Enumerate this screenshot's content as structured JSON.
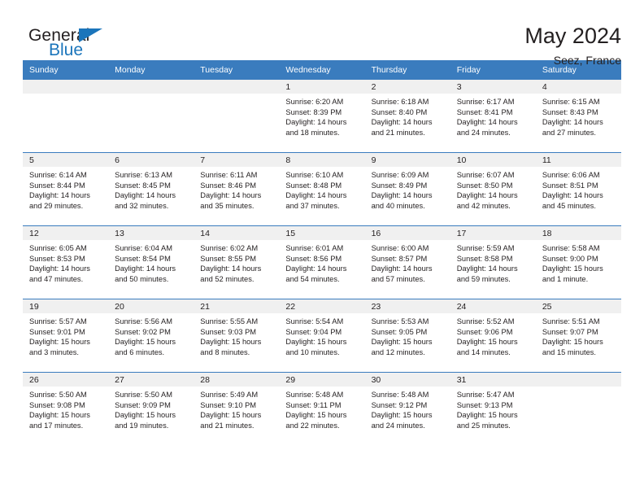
{
  "brand": {
    "name_top": "General",
    "name_bottom": "Blue",
    "accent_color": "#1b75bb"
  },
  "header": {
    "title": "May 2024",
    "subtitle": "Seez, France"
  },
  "theme": {
    "header_bar_color": "#3a7cbe",
    "daynum_band_color": "#f0f0f0",
    "text_color": "#231f20"
  },
  "weekdays": [
    "Sunday",
    "Monday",
    "Tuesday",
    "Wednesday",
    "Thursday",
    "Friday",
    "Saturday"
  ],
  "weeks": [
    [
      {
        "day": "",
        "empty": true
      },
      {
        "day": "",
        "empty": true
      },
      {
        "day": "",
        "empty": true
      },
      {
        "day": "1",
        "sunrise": "Sunrise: 6:20 AM",
        "sunset": "Sunset: 8:39 PM",
        "daylight1": "Daylight: 14 hours",
        "daylight2": "and 18 minutes."
      },
      {
        "day": "2",
        "sunrise": "Sunrise: 6:18 AM",
        "sunset": "Sunset: 8:40 PM",
        "daylight1": "Daylight: 14 hours",
        "daylight2": "and 21 minutes."
      },
      {
        "day": "3",
        "sunrise": "Sunrise: 6:17 AM",
        "sunset": "Sunset: 8:41 PM",
        "daylight1": "Daylight: 14 hours",
        "daylight2": "and 24 minutes."
      },
      {
        "day": "4",
        "sunrise": "Sunrise: 6:15 AM",
        "sunset": "Sunset: 8:43 PM",
        "daylight1": "Daylight: 14 hours",
        "daylight2": "and 27 minutes."
      }
    ],
    [
      {
        "day": "5",
        "sunrise": "Sunrise: 6:14 AM",
        "sunset": "Sunset: 8:44 PM",
        "daylight1": "Daylight: 14 hours",
        "daylight2": "and 29 minutes."
      },
      {
        "day": "6",
        "sunrise": "Sunrise: 6:13 AM",
        "sunset": "Sunset: 8:45 PM",
        "daylight1": "Daylight: 14 hours",
        "daylight2": "and 32 minutes."
      },
      {
        "day": "7",
        "sunrise": "Sunrise: 6:11 AM",
        "sunset": "Sunset: 8:46 PM",
        "daylight1": "Daylight: 14 hours",
        "daylight2": "and 35 minutes."
      },
      {
        "day": "8",
        "sunrise": "Sunrise: 6:10 AM",
        "sunset": "Sunset: 8:48 PM",
        "daylight1": "Daylight: 14 hours",
        "daylight2": "and 37 minutes."
      },
      {
        "day": "9",
        "sunrise": "Sunrise: 6:09 AM",
        "sunset": "Sunset: 8:49 PM",
        "daylight1": "Daylight: 14 hours",
        "daylight2": "and 40 minutes."
      },
      {
        "day": "10",
        "sunrise": "Sunrise: 6:07 AM",
        "sunset": "Sunset: 8:50 PM",
        "daylight1": "Daylight: 14 hours",
        "daylight2": "and 42 minutes."
      },
      {
        "day": "11",
        "sunrise": "Sunrise: 6:06 AM",
        "sunset": "Sunset: 8:51 PM",
        "daylight1": "Daylight: 14 hours",
        "daylight2": "and 45 minutes."
      }
    ],
    [
      {
        "day": "12",
        "sunrise": "Sunrise: 6:05 AM",
        "sunset": "Sunset: 8:53 PM",
        "daylight1": "Daylight: 14 hours",
        "daylight2": "and 47 minutes."
      },
      {
        "day": "13",
        "sunrise": "Sunrise: 6:04 AM",
        "sunset": "Sunset: 8:54 PM",
        "daylight1": "Daylight: 14 hours",
        "daylight2": "and 50 minutes."
      },
      {
        "day": "14",
        "sunrise": "Sunrise: 6:02 AM",
        "sunset": "Sunset: 8:55 PM",
        "daylight1": "Daylight: 14 hours",
        "daylight2": "and 52 minutes."
      },
      {
        "day": "15",
        "sunrise": "Sunrise: 6:01 AM",
        "sunset": "Sunset: 8:56 PM",
        "daylight1": "Daylight: 14 hours",
        "daylight2": "and 54 minutes."
      },
      {
        "day": "16",
        "sunrise": "Sunrise: 6:00 AM",
        "sunset": "Sunset: 8:57 PM",
        "daylight1": "Daylight: 14 hours",
        "daylight2": "and 57 minutes."
      },
      {
        "day": "17",
        "sunrise": "Sunrise: 5:59 AM",
        "sunset": "Sunset: 8:58 PM",
        "daylight1": "Daylight: 14 hours",
        "daylight2": "and 59 minutes."
      },
      {
        "day": "18",
        "sunrise": "Sunrise: 5:58 AM",
        "sunset": "Sunset: 9:00 PM",
        "daylight1": "Daylight: 15 hours",
        "daylight2": "and 1 minute."
      }
    ],
    [
      {
        "day": "19",
        "sunrise": "Sunrise: 5:57 AM",
        "sunset": "Sunset: 9:01 PM",
        "daylight1": "Daylight: 15 hours",
        "daylight2": "and 3 minutes."
      },
      {
        "day": "20",
        "sunrise": "Sunrise: 5:56 AM",
        "sunset": "Sunset: 9:02 PM",
        "daylight1": "Daylight: 15 hours",
        "daylight2": "and 6 minutes."
      },
      {
        "day": "21",
        "sunrise": "Sunrise: 5:55 AM",
        "sunset": "Sunset: 9:03 PM",
        "daylight1": "Daylight: 15 hours",
        "daylight2": "and 8 minutes."
      },
      {
        "day": "22",
        "sunrise": "Sunrise: 5:54 AM",
        "sunset": "Sunset: 9:04 PM",
        "daylight1": "Daylight: 15 hours",
        "daylight2": "and 10 minutes."
      },
      {
        "day": "23",
        "sunrise": "Sunrise: 5:53 AM",
        "sunset": "Sunset: 9:05 PM",
        "daylight1": "Daylight: 15 hours",
        "daylight2": "and 12 minutes."
      },
      {
        "day": "24",
        "sunrise": "Sunrise: 5:52 AM",
        "sunset": "Sunset: 9:06 PM",
        "daylight1": "Daylight: 15 hours",
        "daylight2": "and 14 minutes."
      },
      {
        "day": "25",
        "sunrise": "Sunrise: 5:51 AM",
        "sunset": "Sunset: 9:07 PM",
        "daylight1": "Daylight: 15 hours",
        "daylight2": "and 15 minutes."
      }
    ],
    [
      {
        "day": "26",
        "sunrise": "Sunrise: 5:50 AM",
        "sunset": "Sunset: 9:08 PM",
        "daylight1": "Daylight: 15 hours",
        "daylight2": "and 17 minutes."
      },
      {
        "day": "27",
        "sunrise": "Sunrise: 5:50 AM",
        "sunset": "Sunset: 9:09 PM",
        "daylight1": "Daylight: 15 hours",
        "daylight2": "and 19 minutes."
      },
      {
        "day": "28",
        "sunrise": "Sunrise: 5:49 AM",
        "sunset": "Sunset: 9:10 PM",
        "daylight1": "Daylight: 15 hours",
        "daylight2": "and 21 minutes."
      },
      {
        "day": "29",
        "sunrise": "Sunrise: 5:48 AM",
        "sunset": "Sunset: 9:11 PM",
        "daylight1": "Daylight: 15 hours",
        "daylight2": "and 22 minutes."
      },
      {
        "day": "30",
        "sunrise": "Sunrise: 5:48 AM",
        "sunset": "Sunset: 9:12 PM",
        "daylight1": "Daylight: 15 hours",
        "daylight2": "and 24 minutes."
      },
      {
        "day": "31",
        "sunrise": "Sunrise: 5:47 AM",
        "sunset": "Sunset: 9:13 PM",
        "daylight1": "Daylight: 15 hours",
        "daylight2": "and 25 minutes."
      },
      {
        "day": "",
        "empty": true
      }
    ]
  ]
}
